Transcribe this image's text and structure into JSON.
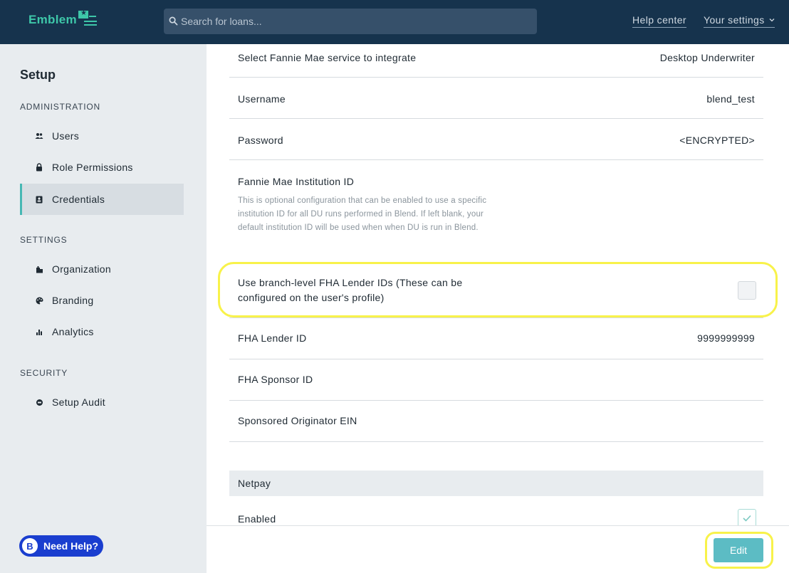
{
  "header": {
    "logo_text": "Emblem",
    "search_placeholder": "Search for loans...",
    "help_center": "Help center",
    "your_settings": "Your settings"
  },
  "sidebar": {
    "title": "Setup",
    "sections": [
      {
        "label": "ADMINISTRATION"
      },
      {
        "label": "SETTINGS"
      },
      {
        "label": "SECURITY"
      }
    ],
    "items": [
      {
        "label": "Users",
        "icon": "users-icon"
      },
      {
        "label": "Role Permissions",
        "icon": "lock-icon"
      },
      {
        "label": "Credentials",
        "icon": "id-badge-icon",
        "active": true
      },
      {
        "label": "Organization",
        "icon": "building-icon"
      },
      {
        "label": "Branding",
        "icon": "palette-icon"
      },
      {
        "label": "Analytics",
        "icon": "bar-chart-icon"
      },
      {
        "label": "Setup Audit",
        "icon": "audit-icon"
      }
    ],
    "need_help": "Need Help?"
  },
  "main": {
    "rows": [
      {
        "label": "Select Fannie Mae service to integrate",
        "value": "Desktop Underwriter"
      },
      {
        "label": "Username",
        "value": "blend_test"
      },
      {
        "label": "Password",
        "value": "<ENCRYPTED>"
      },
      {
        "label": "Fannie Mae Institution ID",
        "description": "This is optional configuration that can be enabled to use a specific institution ID for all DU runs performed in Blend. If left blank, your default institution ID will be used when when DU is run in Blend."
      },
      {
        "label": "Use branch-level FHA Lender IDs (These can be configured on the user's profile)",
        "checked": false
      },
      {
        "label": "FHA Lender ID",
        "value": "9999999999"
      },
      {
        "label": "FHA Sponsor ID",
        "value": ""
      },
      {
        "label": "Sponsored Originator EIN",
        "value": ""
      }
    ],
    "netpay": {
      "title": "Netpay",
      "enabled_label": "Enabled",
      "enabled": true
    }
  },
  "footer": {
    "edit_label": "Edit"
  },
  "colors": {
    "topbar": "#16334d",
    "accent": "#3ec7a9",
    "button": "#5cbcc4",
    "highlight": "#f8f24a",
    "help_button": "#1a3ecf"
  }
}
